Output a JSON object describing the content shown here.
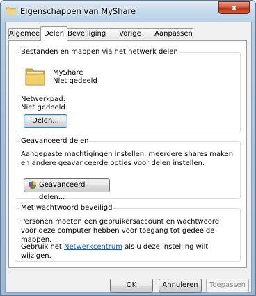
{
  "window": {
    "title": "Eigenschappen van MyShare",
    "close_label": "x"
  },
  "tabs": [
    {
      "label": "Algemeen"
    },
    {
      "label": "Delen"
    },
    {
      "label": "Beveiliging"
    },
    {
      "label": "Vorige versies"
    },
    {
      "label": "Aanpassen"
    }
  ],
  "network_sharing": {
    "group_title": "Bestanden en mappen via het netwerk delen",
    "folder_name": "MyShare",
    "folder_status": "Niet gedeeld",
    "network_path_label": "Netwerkpad:",
    "network_path_value": "Niet gedeeld",
    "share_button": "Delen..."
  },
  "advanced_sharing": {
    "group_title": "Geavanceerd delen",
    "description": "Aangepaste machtigingen instellen, meerdere shares maken en andere geavanceerde opties voor delen instellen.",
    "button": "Geavanceerd delen..."
  },
  "password_protection": {
    "group_title": "Met wachtwoord beveiligd",
    "description": "Personen moeten een gebruikersaccount en wachtwoord voor deze computer hebben voor toegang tot gedeelde mappen.",
    "change_prefix": "Gebruik het",
    "link": "Netwerkcentrum",
    "change_suffix": "als u deze instelling wilt wijzigen."
  },
  "footer": {
    "ok": "OK",
    "cancel": "Annuleren",
    "apply": "Toepassen"
  }
}
